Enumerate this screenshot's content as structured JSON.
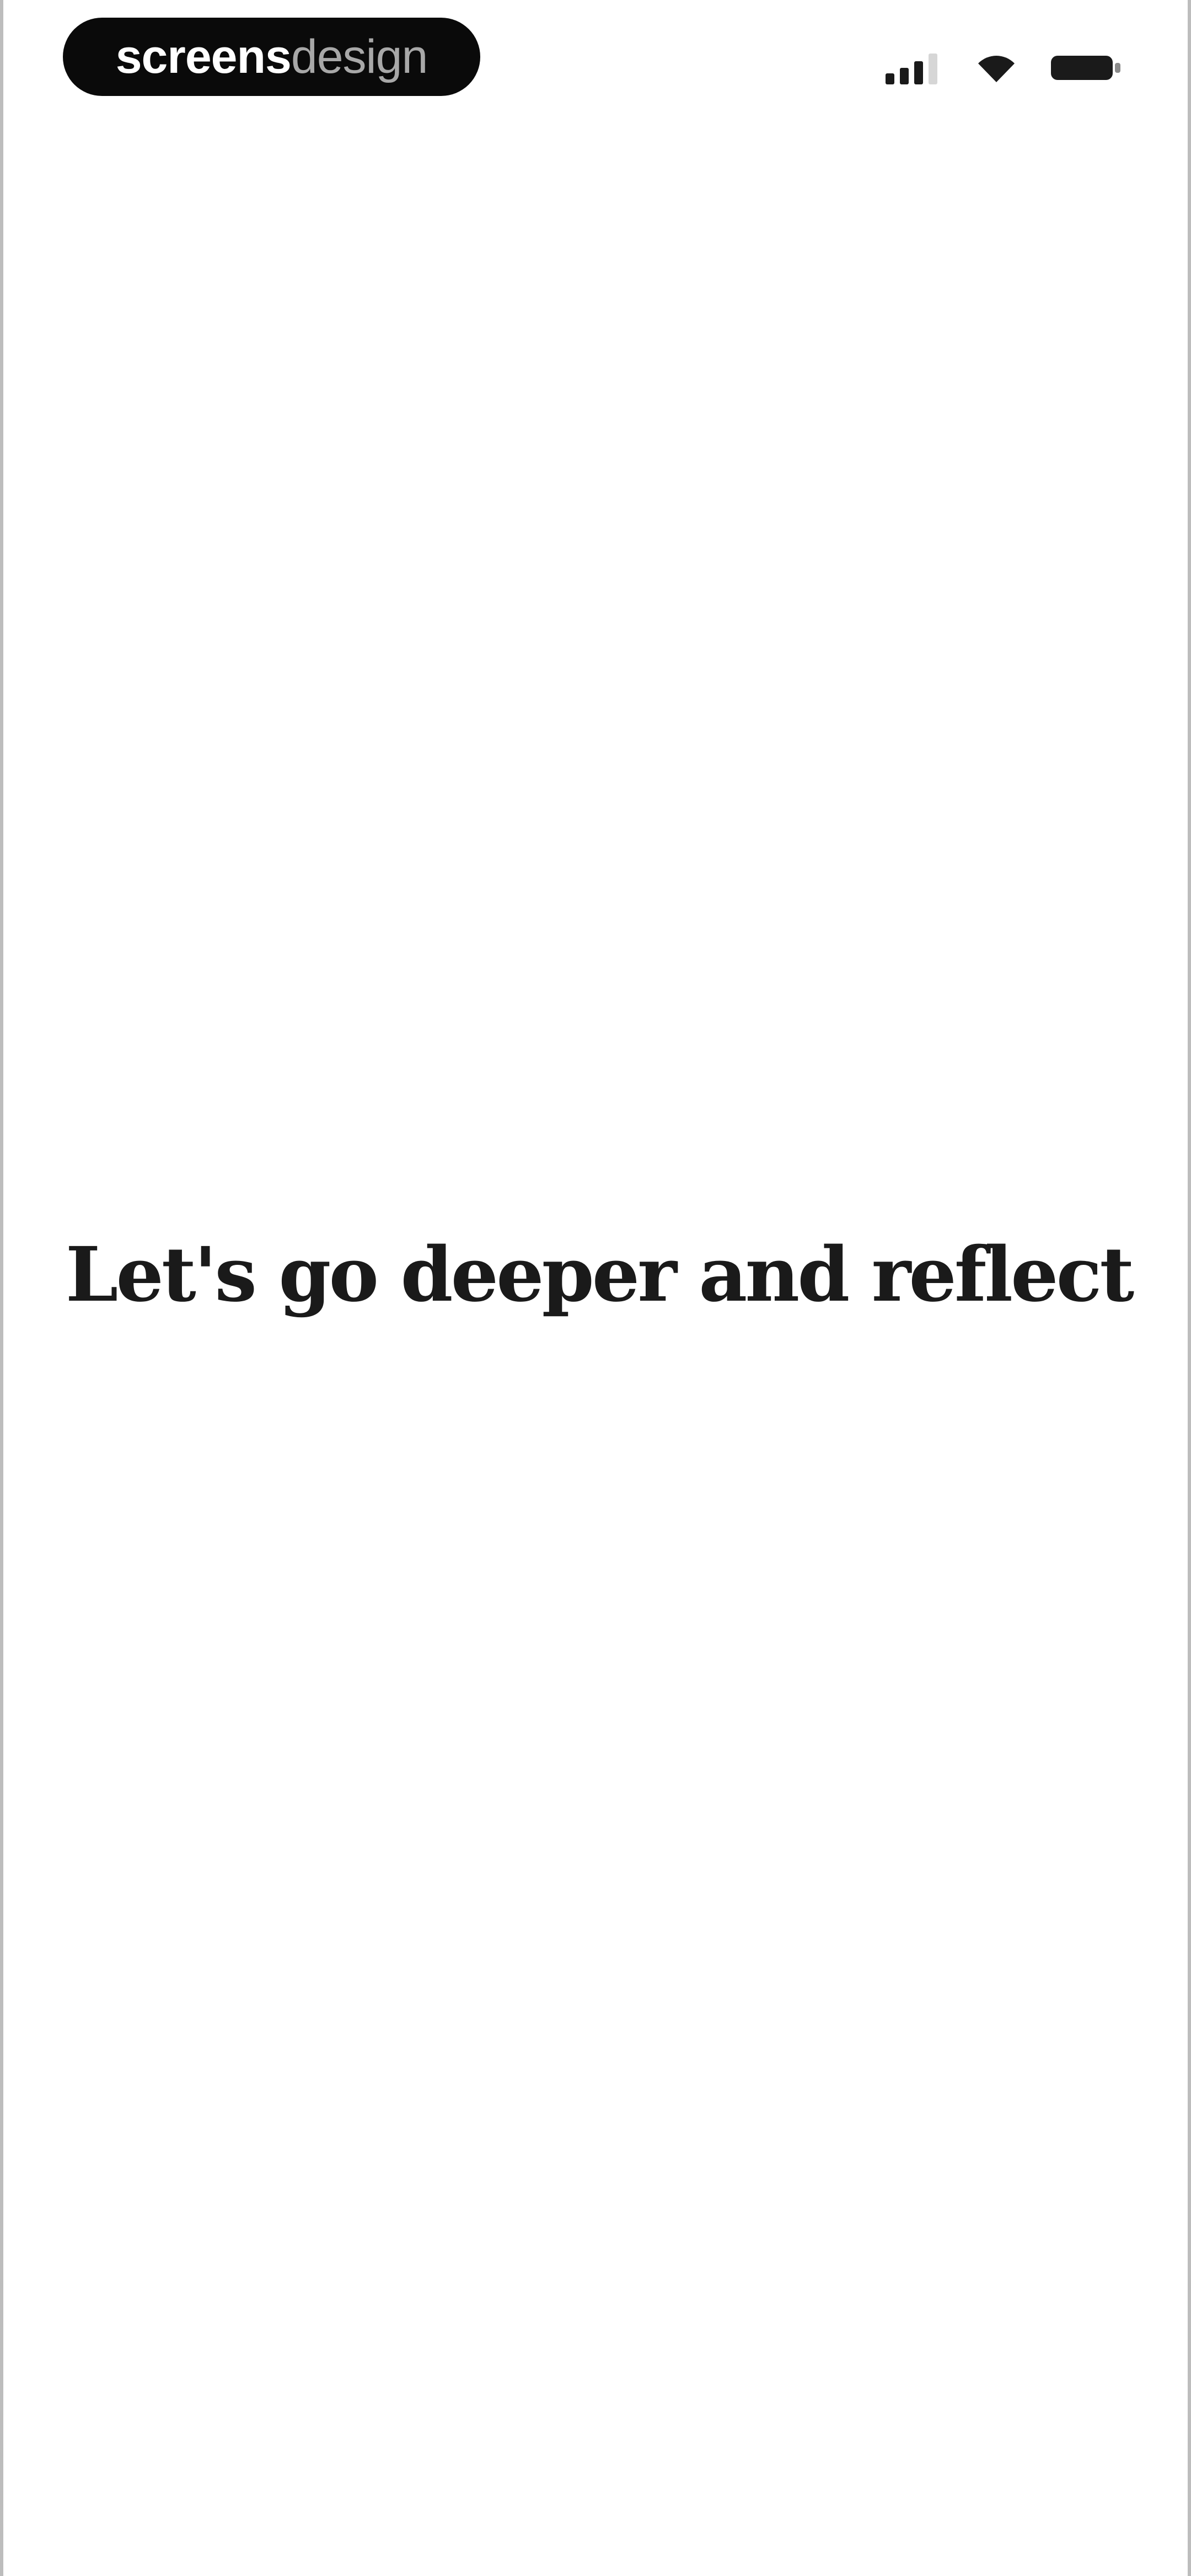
{
  "status_bar": {
    "brand": {
      "strong": "screens",
      "light": "design"
    },
    "icons": [
      "cellular-signal-icon",
      "wifi-icon",
      "battery-icon"
    ]
  },
  "main": {
    "headline": "Let's go deeper and reflect"
  },
  "colors": {
    "background": "#ffffff",
    "text": "#1a1a1a",
    "pill": "#0a0a0a"
  }
}
